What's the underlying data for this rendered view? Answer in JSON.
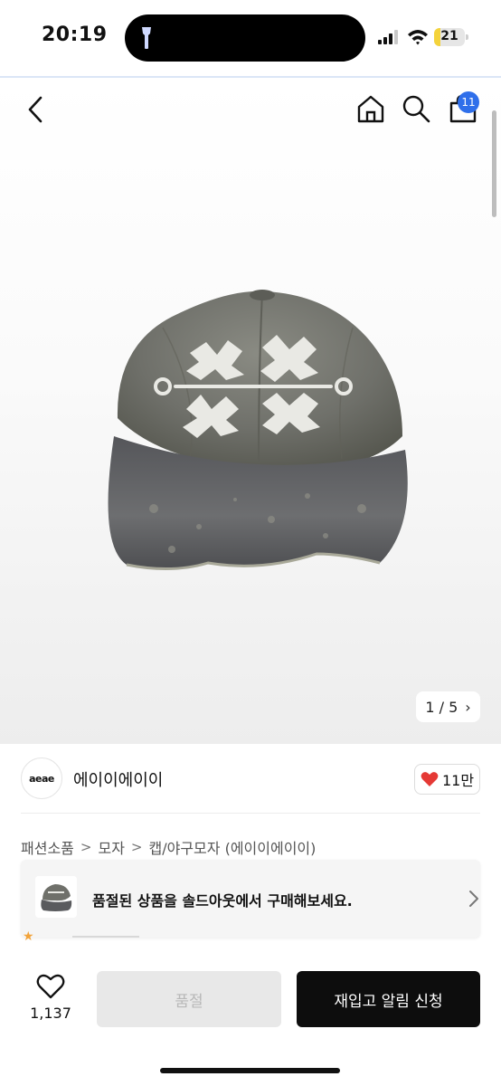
{
  "status_bar": {
    "time": "20:19",
    "battery": "21",
    "battery_level": 0.21
  },
  "colors": {
    "badge": "#2f6fea",
    "heart": "#e53935",
    "battery": "#f4d33b",
    "primary_button": "#0d0d0d"
  },
  "header": {
    "back_icon": "chevron-left-icon",
    "home_icon": "home-icon",
    "search_icon": "search-icon",
    "cart_icon": "shopping-bag-icon",
    "cart_badge": "11"
  },
  "gallery": {
    "counter": "1 / 5",
    "counter_chevron": "›",
    "image_alt": "gray distressed baseball cap"
  },
  "seller": {
    "logo_text": "aeae",
    "name": "에이이에이이",
    "likes": "11만"
  },
  "breadcrumb": {
    "items": [
      "패션소품",
      "모자",
      "캡/야구모자 (에이이에이이)"
    ],
    "separator": ">"
  },
  "banner": {
    "text": "품절된 상품을 솔드아웃에서 구매해보세요."
  },
  "bottom_bar": {
    "wish_count": "1,137",
    "soldout_label": "품절",
    "restock_label": "재입고 알림 신청"
  }
}
